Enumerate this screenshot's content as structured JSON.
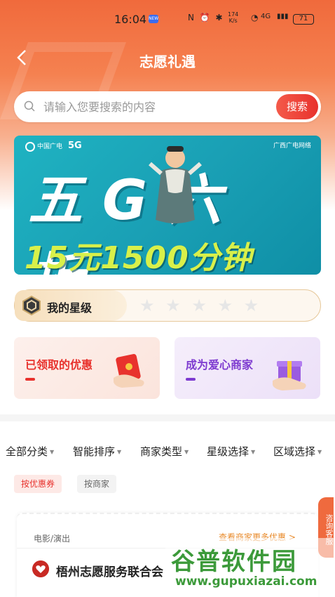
{
  "status_bar": {
    "time": "16:04",
    "badge": "NEW",
    "icons": "N ⏰ ✱",
    "speed": "174\nK/s",
    "network": "4G",
    "battery": "71"
  },
  "nav": {
    "title": "志愿礼遇",
    "back": "‹"
  },
  "search": {
    "placeholder": "请输入您要搜索的内容",
    "button": "搜索"
  },
  "banner": {
    "logo_left": "中国广电",
    "logo_5g": "5G",
    "logo_right": "广西广电网络",
    "headline": "五G六折",
    "subline": "15元1500分钟"
  },
  "star_level": {
    "label": "我的星级",
    "stars": [
      "★",
      "★",
      "★",
      "★",
      "★"
    ],
    "filled": 0,
    "star_color": "#e6e6e6"
  },
  "promos": {
    "left_title": "已领取的优惠",
    "right_title": "成为爱心商家"
  },
  "filters": [
    {
      "label": "全部分类"
    },
    {
      "label": "智能排序"
    },
    {
      "label": "商家类型"
    },
    {
      "label": "星级选择"
    },
    {
      "label": "区域选择"
    }
  ],
  "tags": {
    "active": "按优惠券",
    "normal": "按商家"
  },
  "merchant": {
    "category": "电影/演出",
    "more": "查看商家更多优惠 >",
    "name": "梧州志愿服务联合会"
  },
  "consult_tab": "咨询客服",
  "watermark": {
    "title": "谷普软件园",
    "url": "www.gupuxiazai.com"
  },
  "colors": {
    "accent": "#e8322d",
    "hero": "#f06a3c",
    "purple": "#7e3bd0"
  }
}
